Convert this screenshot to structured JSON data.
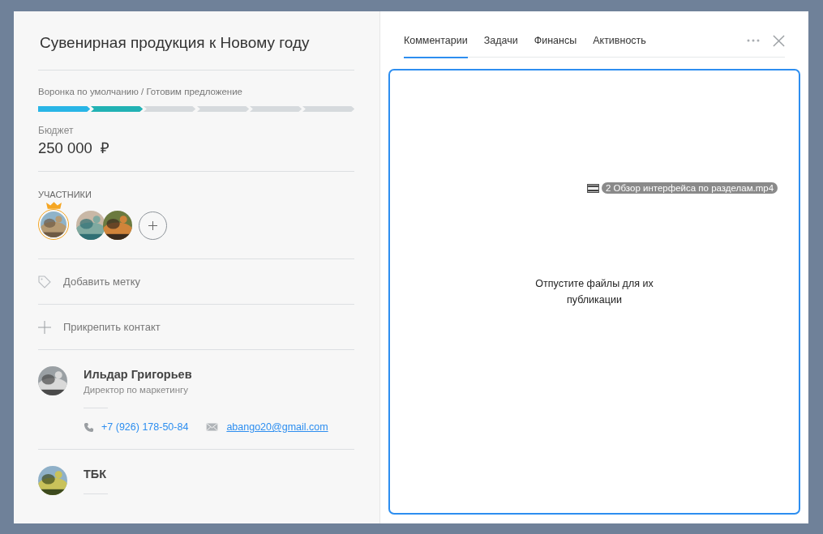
{
  "deal": {
    "title": "Сувенирная продукция к Новому году",
    "funnel": {
      "path": "Воронка по умолчанию / Готовим предложение",
      "stages": [
        {
          "color": "#29b5e6"
        },
        {
          "color": "#22b2b4"
        },
        {
          "color": "#d6dadd"
        },
        {
          "color": "#d6dadd"
        },
        {
          "color": "#d6dadd"
        },
        {
          "color": "#d6dadd"
        }
      ]
    },
    "budget": {
      "label": "Бюджет",
      "value": "250 000",
      "currency": "₽"
    },
    "participants": {
      "label": "УЧАСТНИКИ",
      "members": [
        {
          "owner": true
        },
        {
          "owner": false
        },
        {
          "owner": false
        }
      ]
    },
    "actions": [
      {
        "kind": "tag",
        "label": "Добавить метку"
      },
      {
        "kind": "plus",
        "label": "Прикрепить контакт"
      }
    ],
    "contacts": [
      {
        "name": "Ильдар Григорьев",
        "position": "Директор по маркетингу",
        "phone": "+7 (926) 178-50-84",
        "email": "abango20@gmail.com"
      },
      {
        "name": "ТБК"
      }
    ]
  },
  "tabs": [
    {
      "label": "Комментарии",
      "selected": true
    },
    {
      "label": "Задачи",
      "selected": false
    },
    {
      "label": "Финансы",
      "selected": false
    },
    {
      "label": "Активность",
      "selected": false
    }
  ],
  "dropzone": {
    "message": "Отпустите файлы для их публикации",
    "dragged_file": "2 Обзор интерфейса по разделам.mp4"
  }
}
